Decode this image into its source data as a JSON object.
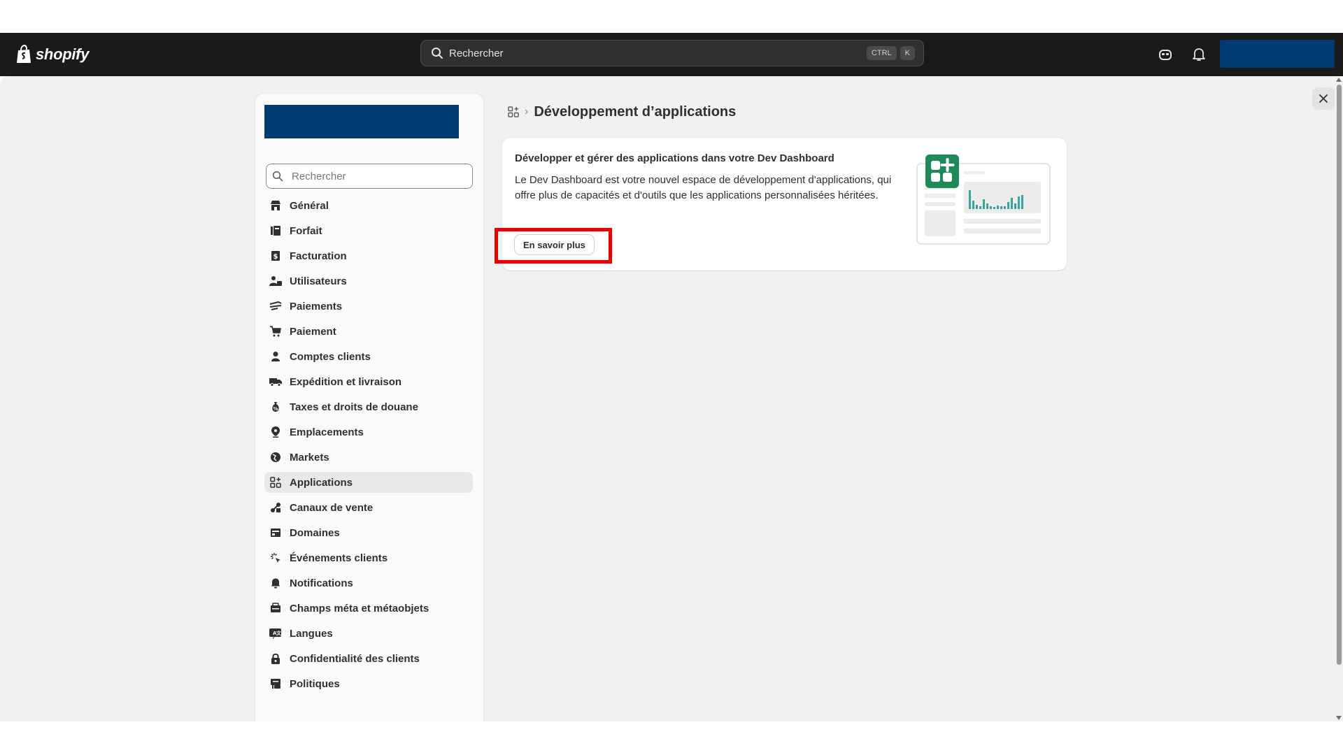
{
  "topbar": {
    "brand": "shopify",
    "search_placeholder": "Rechercher",
    "shortcut_keys": [
      "CTRL",
      "K"
    ]
  },
  "sidebar": {
    "search_placeholder": "Rechercher",
    "items": [
      {
        "label": "Général",
        "icon": "store-icon"
      },
      {
        "label": "Forfait",
        "icon": "plan-icon"
      },
      {
        "label": "Facturation",
        "icon": "billing-icon"
      },
      {
        "label": "Utilisateurs",
        "icon": "users-icon"
      },
      {
        "label": "Paiements",
        "icon": "payments-icon"
      },
      {
        "label": "Paiement",
        "icon": "cart-icon"
      },
      {
        "label": "Comptes clients",
        "icon": "person-icon"
      },
      {
        "label": "Expédition et livraison",
        "icon": "truck-icon"
      },
      {
        "label": "Taxes et droits de douane",
        "icon": "tax-icon"
      },
      {
        "label": "Emplacements",
        "icon": "location-icon"
      },
      {
        "label": "Markets",
        "icon": "globe-icon"
      },
      {
        "label": "Applications",
        "icon": "apps-icon",
        "active": true
      },
      {
        "label": "Canaux de vente",
        "icon": "channels-icon"
      },
      {
        "label": "Domaines",
        "icon": "domains-icon"
      },
      {
        "label": "Événements clients",
        "icon": "events-icon"
      },
      {
        "label": "Notifications",
        "icon": "bell-icon"
      },
      {
        "label": "Champs méta et métaobjets",
        "icon": "metafields-icon"
      },
      {
        "label": "Langues",
        "icon": "languages-icon"
      },
      {
        "label": "Confidentialité des clients",
        "icon": "lock-icon"
      },
      {
        "label": "Politiques",
        "icon": "policies-icon"
      }
    ]
  },
  "content": {
    "breadcrumb_separator": "›",
    "page_title": "Développement d’applications",
    "card": {
      "title": "Développer et gérer des applications dans votre Dev Dashboard",
      "body": "Le Dev Dashboard est votre nouvel espace de développement d'applications, qui offre plus de capacités et d'outils que les applications personnalisées héritées.",
      "button_label": "En savoir plus"
    }
  },
  "colors": {
    "topbar_bg": "#1a1a1a",
    "redacted_block": "#003a70",
    "highlight": "#ee0000",
    "illustration_green": "#1e8a5a",
    "chart_teal": "#3aa59a"
  }
}
